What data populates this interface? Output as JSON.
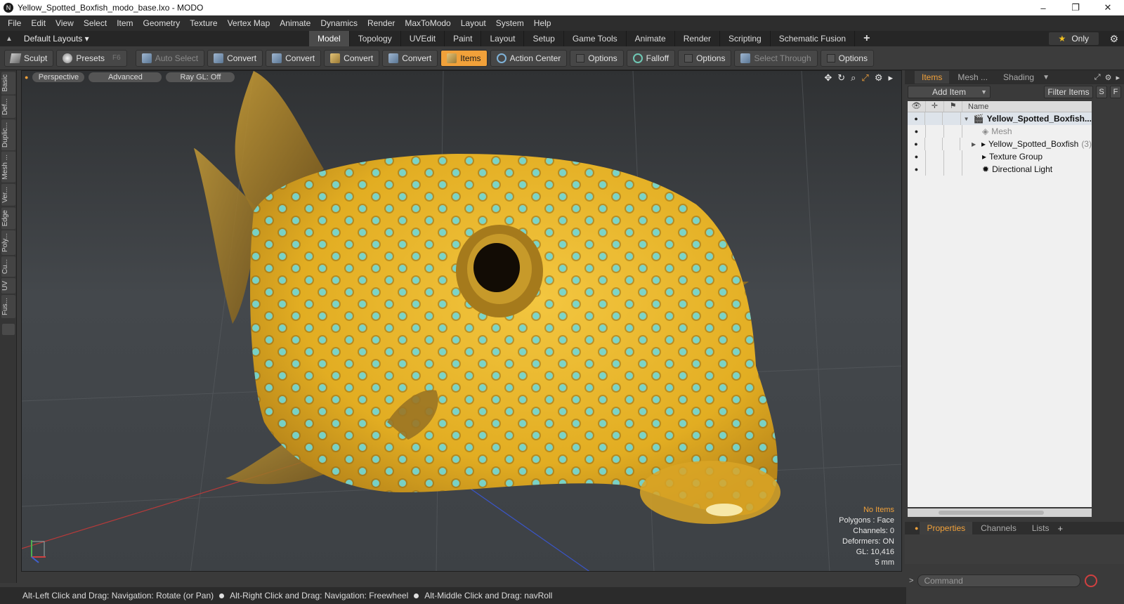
{
  "window": {
    "title": "Yellow_Spotted_Boxfish_modo_base.lxo - MODO",
    "minimize_glyph": "–",
    "restore_glyph": "❐",
    "close_glyph": "✕"
  },
  "menu": [
    "File",
    "Edit",
    "View",
    "Select",
    "Item",
    "Geometry",
    "Texture",
    "Vertex Map",
    "Animate",
    "Dynamics",
    "Render",
    "MaxToModo",
    "Layout",
    "System",
    "Help"
  ],
  "layout_bar": {
    "layouts_label": "Default Layouts ▾",
    "tabs": [
      "Model",
      "Topology",
      "UVEdit",
      "Paint",
      "Layout",
      "Setup",
      "Game Tools",
      "Animate",
      "Render",
      "Scripting",
      "Schematic Fusion"
    ],
    "active_tab": "Model",
    "plus": "+",
    "only_label": "Only",
    "star": "★"
  },
  "toolbar": {
    "sculpt": "Sculpt",
    "presets": "Presets",
    "presets_hotkey": "F6",
    "auto_select": "Auto Select",
    "convert1": "Convert",
    "convert2": "Convert",
    "convert3": "Convert",
    "convert4": "Convert",
    "items": "Items",
    "action_center": "Action Center",
    "options1": "Options",
    "falloff": "Falloff",
    "options2": "Options",
    "select_through": "Select Through",
    "options3": "Options"
  },
  "left_tabs": [
    "Basic",
    "Def...",
    "Duplic...",
    "Mesh ...",
    "Ver...",
    "Edge",
    "Poly...",
    "Cu...",
    "UV",
    "Fus..."
  ],
  "viewport": {
    "view_mode": "Perspective",
    "shading": "Advanced",
    "raygl": "Ray GL: Off",
    "info": {
      "selection": "No Items",
      "polygons": "Polygons : Face",
      "channels": "Channels: 0",
      "deformers": "Deformers: ON",
      "gl": "GL: 10,416",
      "scale": "5 mm"
    }
  },
  "right_panel": {
    "tabs": [
      "Items",
      "Mesh ...",
      "Shading"
    ],
    "add_item": "Add Item",
    "filter_items": "Filter Items",
    "s_btn": "S",
    "f_btn": "F",
    "name_header": "Name",
    "items": [
      {
        "name": "Yellow_Spotted_Boxfish...",
        "count": ""
      },
      {
        "name": "Mesh",
        "count": ""
      },
      {
        "name": "Yellow_Spotted_Boxfish",
        "count": "(3)"
      },
      {
        "name": "Texture Group",
        "count": ""
      },
      {
        "name": "Directional Light",
        "count": ""
      }
    ],
    "bottom_tabs": [
      "Properties",
      "Channels",
      "Lists"
    ],
    "bottom_plus": "+",
    "command_placeholder": "Command",
    "command_arrow": ">"
  },
  "status": {
    "hint1": "Alt-Left Click and Drag: Navigation: Rotate (or Pan)",
    "hint2": "Alt-Right Click and Drag: Navigation: Freewheel",
    "hint3": "Alt-Middle Click and Drag: navRoll"
  },
  "colors": {
    "accent": "#f1a13a",
    "fish_body": "#e9b82c",
    "fish_spot": "#6fd7d8"
  }
}
